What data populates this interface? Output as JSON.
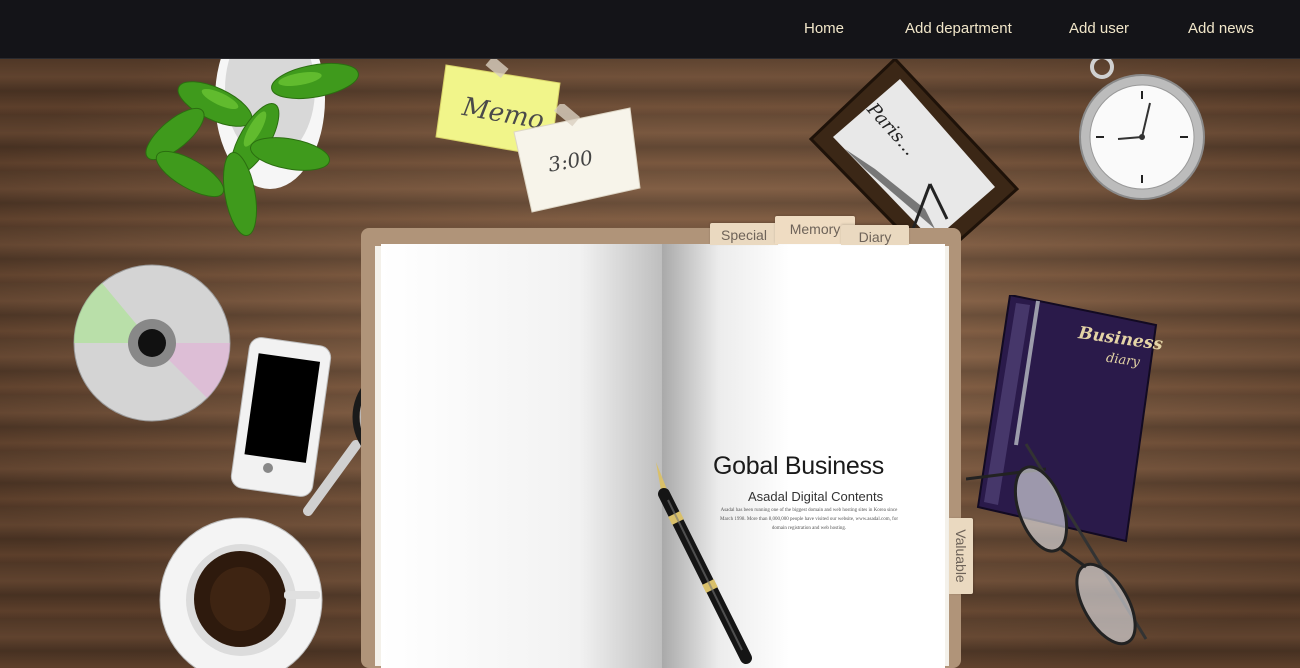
{
  "nav": {
    "items": [
      {
        "label": "Home"
      },
      {
        "label": "Add department"
      },
      {
        "label": "Add user"
      },
      {
        "label": "Add news"
      }
    ]
  },
  "desk": {
    "memo_note": "Memo",
    "time_note": "3:00",
    "photo_caption": "Paris...",
    "diary_title": "Business",
    "diary_subtitle": "diary"
  },
  "notebook": {
    "tabs": [
      "Special",
      "Memory",
      "Diary"
    ],
    "side_tab": "Valuable",
    "title": "Gobal Business",
    "subtitle": "Asadal Digital Contents",
    "blurb": "Asadal has been running one of the biggest domain and web hosting sites in Korea since March 1998. More than 8,000,000 people have visited our website, www.asadal.com, for domain registration and web hosting."
  },
  "colors": {
    "nav_bg": "#141418",
    "nav_text": "#f1e6c9",
    "wood": "#6b4a33",
    "diary_cover": "#2a1a4a"
  }
}
